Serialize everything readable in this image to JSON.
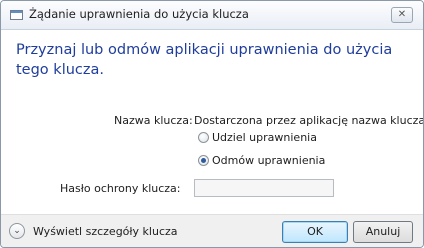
{
  "window": {
    "title": "Żądanie uprawnienia do użycia klucza",
    "close_symbol": "✕"
  },
  "main_instruction": "Przyznaj lub odmów aplikacji uprawnienia do użycia tego klucza.",
  "key_name": {
    "label": "Nazwa klucza:",
    "value": "Dostarczona przez aplikację nazwa klucza"
  },
  "options": [
    {
      "label": "Udziel uprawnienia",
      "selected": false
    },
    {
      "label": "Odmów uprawnienia",
      "selected": true
    }
  ],
  "password": {
    "label": "Hasło ochrony klucza:",
    "value": ""
  },
  "footer": {
    "details_label": "Wyświetl szczegóły klucza",
    "ok_label": "OK",
    "cancel_label": "Anuluj"
  },
  "icons": {
    "app": "window-icon",
    "expand": "chevron-down-icon",
    "close": "close-icon"
  }
}
